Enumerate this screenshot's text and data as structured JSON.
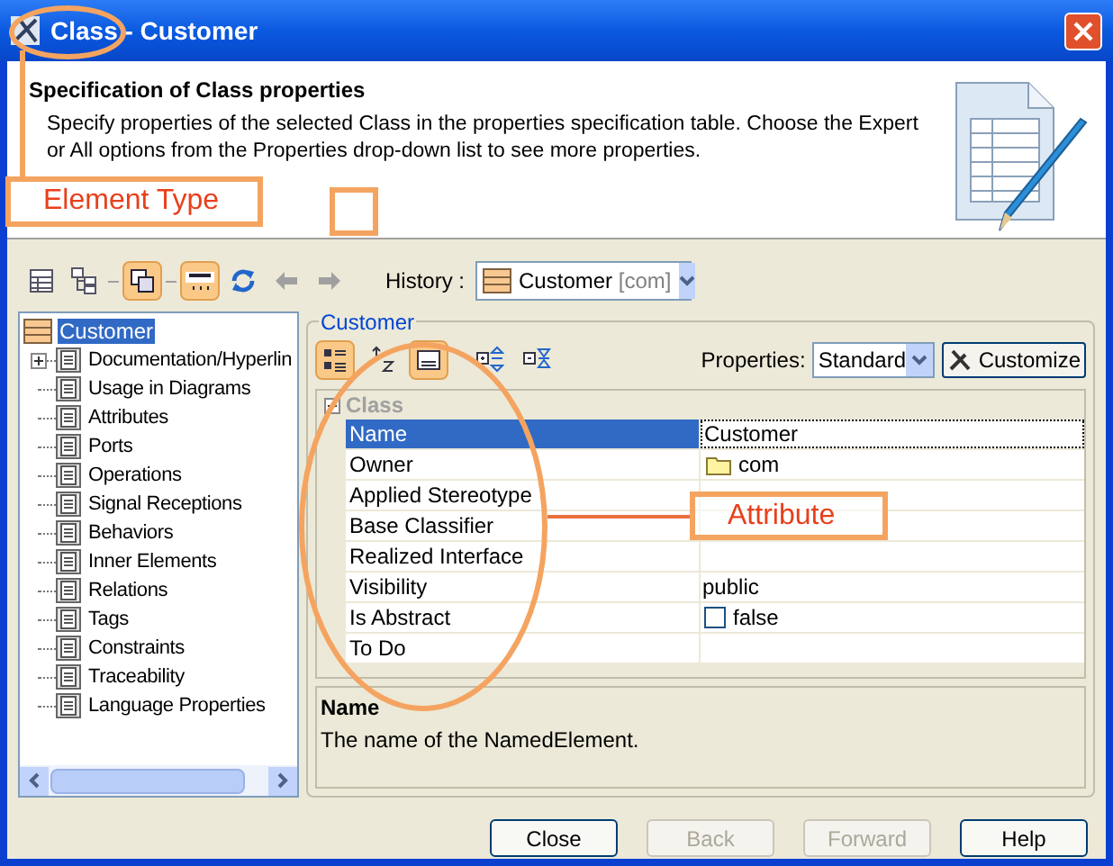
{
  "window": {
    "title": "Class - Customer"
  },
  "header": {
    "heading": "Specification of Class properties",
    "description": "Specify properties of the selected Class in the properties specification table. Choose the Expert or All options from the Properties drop-down list to see more properties."
  },
  "toolbar": {
    "buttons": [
      {
        "kind": "table",
        "pressed": false
      },
      {
        "kind": "tree",
        "pressed": false
      },
      {
        "kind": "windows",
        "pressed": true
      },
      {
        "kind": "abc",
        "pressed": true
      },
      {
        "kind": "refresh",
        "pressed": false
      },
      {
        "kind": "back",
        "pressed": false
      },
      {
        "kind": "forward",
        "pressed": false
      }
    ],
    "history_label": "History :",
    "history_value": "Customer",
    "history_owner": "[com]"
  },
  "tree": {
    "root": {
      "label": "Customer",
      "selected": true
    },
    "items": [
      {
        "label": "Documentation/Hyperlin",
        "expandable": true,
        "selected": false
      },
      {
        "label": "Usage in Diagrams",
        "expandable": false,
        "selected": false
      },
      {
        "label": "Attributes",
        "expandable": false,
        "selected": false
      },
      {
        "label": "Ports",
        "expandable": false,
        "selected": false
      },
      {
        "label": "Operations",
        "expandable": false,
        "selected": false
      },
      {
        "label": "Signal Receptions",
        "expandable": false,
        "selected": false
      },
      {
        "label": "Behaviors",
        "expandable": false,
        "selected": false
      },
      {
        "label": "Inner Elements",
        "expandable": false,
        "selected": false
      },
      {
        "label": "Relations",
        "expandable": false,
        "selected": false
      },
      {
        "label": "Tags",
        "expandable": false,
        "selected": false
      },
      {
        "label": "Constraints",
        "expandable": false,
        "selected": false
      },
      {
        "label": "Traceability",
        "expandable": false,
        "selected": false
      },
      {
        "label": "Language Properties",
        "expandable": false,
        "selected": false
      }
    ]
  },
  "properties": {
    "group_title": "Customer",
    "tool_buttons": [
      {
        "kind": "categorized",
        "pressed": true
      },
      {
        "kind": "sort",
        "pressed": false
      },
      {
        "kind": "description",
        "pressed": true
      },
      {
        "kind": "expand",
        "pressed": false
      },
      {
        "kind": "collapse",
        "pressed": false
      }
    ],
    "mode_label": "Properties:",
    "mode_value": "Standard",
    "customize": "Customize",
    "category": "Class",
    "rows": [
      {
        "name": "Name",
        "value": "Customer",
        "kind": "text",
        "selected": true
      },
      {
        "name": "Owner",
        "value": "com",
        "kind": "folder",
        "selected": false
      },
      {
        "name": "Applied Stereotype",
        "selected": false
      },
      {
        "name": "Base Classifier",
        "selected": false
      },
      {
        "name": "Realized Interface",
        "selected": false
      },
      {
        "name": "Visibility",
        "value": "public",
        "kind": "text",
        "selected": false
      },
      {
        "name": "Is Abstract",
        "value": "false",
        "kind": "checkbox",
        "checked": false,
        "selected": false
      },
      {
        "name": "To Do",
        "selected": false
      }
    ],
    "description_title": "Name",
    "description_text": "The name of the NamedElement."
  },
  "buttons": [
    {
      "label": "Close",
      "disabled": false
    },
    {
      "label": "Back",
      "disabled": true
    },
    {
      "label": "Forward",
      "disabled": true
    },
    {
      "label": "Help",
      "disabled": false
    }
  ],
  "annotations": [
    {
      "kind": "element_type",
      "label": "Element Type"
    },
    {
      "kind": "attribute",
      "label": "Attribute"
    }
  ]
}
